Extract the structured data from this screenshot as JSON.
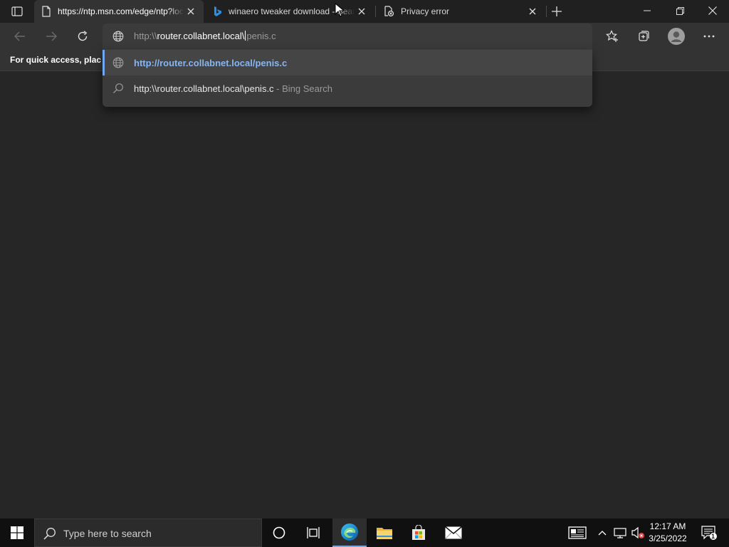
{
  "tabs": [
    {
      "title": "https://ntp.msn.com/edge/ntp?locale=en-US",
      "active": true,
      "icon": "page-icon"
    },
    {
      "title": "winaero tweaker download - Search",
      "active": false,
      "icon": "bing-icon"
    },
    {
      "title": "Privacy error",
      "active": false,
      "icon": "privacy-error-icon"
    }
  ],
  "omnibox": {
    "prefix": "http:\\\\",
    "host": "router.collabnet.local\\",
    "rest": "penis.c"
  },
  "suggestions": [
    {
      "text": "http://router.collabnet.local/penis.c",
      "suffix": "",
      "icon": "globe-icon",
      "selected": true
    },
    {
      "text": "http:\\\\router.collabnet.local\\penis.c",
      "suffix": " - Bing Search",
      "icon": "search-icon",
      "selected": false
    }
  ],
  "favorites_bar": {
    "text": "For quick access, place your favorites here on the favorites bar."
  },
  "taskbar": {
    "search_placeholder": "Type here to search",
    "time": "12:17 AM",
    "date": "3/25/2022",
    "notification_count": "1"
  },
  "colors": {
    "accent": "#6ea6f0",
    "edge_blue": "#0f7fd6",
    "folder_yellow": "#f2c94c"
  }
}
